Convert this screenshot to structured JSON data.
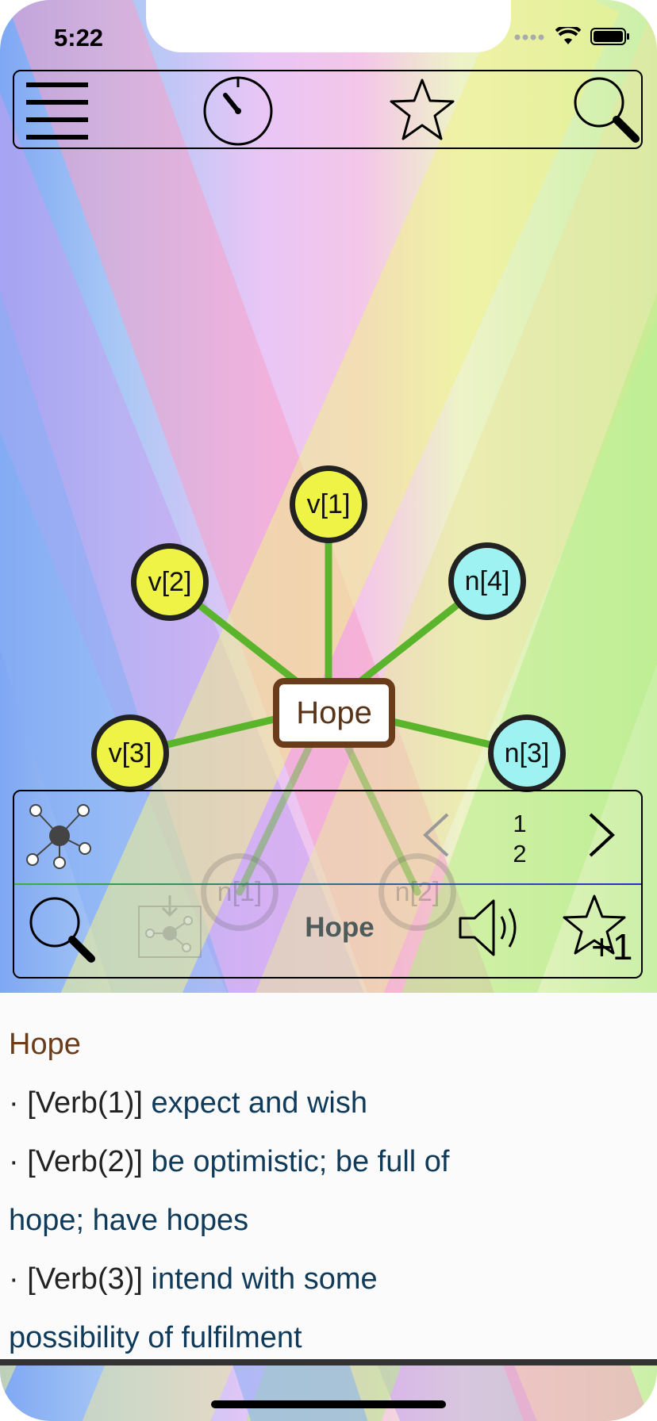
{
  "status": {
    "time": "5:22"
  },
  "toolbar": {
    "menu_icon": "hamburger-menu-icon",
    "timer_icon": "timer-icon",
    "favorites_icon": "star-icon",
    "search_icon": "search-icon"
  },
  "graph": {
    "center": "Hope",
    "nodes": [
      {
        "label": "v[1]",
        "kind": "verb"
      },
      {
        "label": "v[2]",
        "kind": "verb"
      },
      {
        "label": "n[4]",
        "kind": "noun"
      },
      {
        "label": "v[3]",
        "kind": "verb"
      },
      {
        "label": "n[3]",
        "kind": "noun"
      },
      {
        "label": "n[1]",
        "kind": "noun"
      },
      {
        "label": "n[2]",
        "kind": "noun"
      }
    ],
    "colors": {
      "verb": "#eef345",
      "noun": "#9ff2f2",
      "edge": "#5ab42c",
      "center_border": "#6b3c1a"
    }
  },
  "panel": {
    "page_current": "1",
    "page_total": "2",
    "word": "Hope"
  },
  "definitions": {
    "title": "Hope",
    "lines": [
      {
        "tag": "· [Verb(1)]",
        "text": " expect and wish"
      },
      {
        "tag": "· [Verb(2)]",
        "text": " be optimistic; be full of"
      },
      {
        "tag": "",
        "text": "hope; have hopes"
      },
      {
        "tag": "· [Verb(3)]",
        "text": " intend with some"
      },
      {
        "tag": "",
        "text": "possibility of fulfilment"
      }
    ]
  }
}
